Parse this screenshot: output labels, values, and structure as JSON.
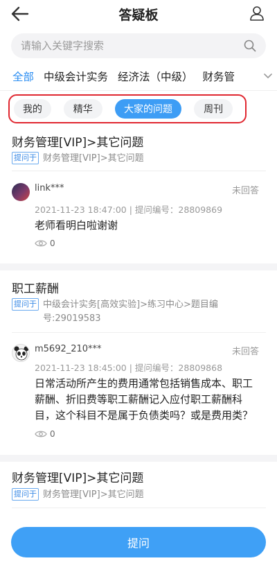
{
  "header": {
    "title": "答疑板"
  },
  "search": {
    "placeholder": "请输入关键字搜索"
  },
  "categories": [
    "全部",
    "中级会计实务",
    "经济法（中级）",
    "财务管"
  ],
  "subtabs": [
    "我的",
    "精华",
    "大家的问题",
    "周刊"
  ],
  "subtab_active_index": 2,
  "posts": [
    {
      "title": "财务管理[VIP]>其它问题",
      "tag": "提问于",
      "path": "财务管理[VIP]>其它问题",
      "user": "link***",
      "status": "未回答",
      "meta": "2021-11-23 18:47:00 | 提问编号：28809869",
      "question": "老师看明白啦谢谢",
      "views": "0"
    },
    {
      "title": "职工薪酬",
      "tag": "提问于",
      "path": "中级会计实务[高效实验]>练习中心>题目编号:29019583",
      "user": "m5692_210***",
      "status": "未回答",
      "meta": "2021-11-23 18:45:00 | 提问编号：28809868",
      "question": "日常活动所产生的费用通常包括销售成本、职工薪酬、折旧费等职工薪酬记入应付职工薪酬科目，这个科目不是属于负债类吗？或是费用类？",
      "views": "0"
    },
    {
      "title": "财务管理[VIP]>其它问题",
      "tag": "提问于",
      "path": "财务管理[VIP]>其它问题"
    }
  ],
  "ask_button": "提问",
  "colors": {
    "accent": "#3fa0f6",
    "highlight_box": "#e0262f",
    "tag_border": "#69a9ee"
  }
}
